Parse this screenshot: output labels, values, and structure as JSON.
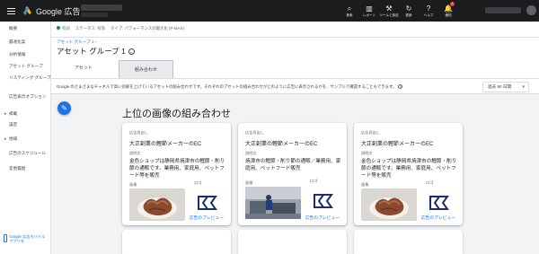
{
  "app": {
    "title": "Google 広告"
  },
  "toolbar": [
    {
      "name": "search",
      "icon": "⌕",
      "label": "検索"
    },
    {
      "name": "reports",
      "icon": "▥",
      "label": "レポート"
    },
    {
      "name": "tools",
      "icon": "⚒",
      "label": "ツールと設定"
    },
    {
      "name": "refresh",
      "icon": "↻",
      "label": "更新"
    },
    {
      "name": "help",
      "icon": "?",
      "label": "ヘルプ"
    },
    {
      "name": "notifications",
      "icon": "🔔",
      "label": "通知",
      "badge": "1"
    }
  ],
  "sidebar": {
    "items": [
      {
        "label": "概要"
      },
      {
        "label": "最適化案"
      },
      {
        "label": "分析情報"
      },
      {
        "label": "アセット グループ"
      },
      {
        "label": "リスティング グループ"
      },
      {
        "label": "広告表示オプション"
      },
      {
        "label": "掲載",
        "caret": "▸"
      },
      {
        "label": "設定"
      },
      {
        "label": "地域",
        "caret": "▸"
      },
      {
        "label": "広告のスケジュール"
      },
      {
        "label": "変更履歴"
      }
    ],
    "mobile_banner": "Google 広告モバイルアプリを"
  },
  "status": {
    "enabled": "有効",
    "status_label": "ステータス: 有効",
    "type": "タイプ: パフォーマンスの最大化 (P-MAX)"
  },
  "breadcrumb": "アセット グループ 1 ›",
  "page_title": "アセット グループ 1",
  "tabs": [
    {
      "label": "アセット",
      "active": false
    },
    {
      "label": "組み合わせ",
      "active": true
    }
  ],
  "info": {
    "text": "Google のさまざまなチャネルで高い効果を上げているアセットの組み合わせです。それぞれのアセットの組み合わせがどのように広告に表示されるかを、サンプルで確認することもできます。",
    "help_icon": "?"
  },
  "date_range": {
    "value": "過去 90 日間",
    "chevron": "▾"
  },
  "fab": {
    "icon": "✎"
  },
  "section_title": "上位の画像の組み合わせ",
  "labels": {
    "headline": "広告見出し",
    "description": "説明文",
    "image": "画像",
    "logo": "ロゴ",
    "preview": "広告のプレビュー"
  },
  "cards": [
    {
      "headline": "大正創業の鰹節メーカーのEC",
      "description": "金色ショップは静岡県焼津市の鰹節・削り節の通販です。業務用、家庭用、ペットフード等を販売",
      "image": "food"
    },
    {
      "headline": "大正創業の鰹節メーカーのEC",
      "description": "焼津市の鰹節・削り節の通販／業務用、家庭用、ペットフード販売",
      "image": "factory"
    },
    {
      "headline": "大正創業の鰹節メーカーのEC",
      "description": "金色ショップは静岡県焼津市の鰹節・削り節の通販です。業務用、家庭用、ペットフード等を販売",
      "image": "food"
    }
  ],
  "colors": {
    "brand_blue": "#1a73e8",
    "topbar": "#1a1c1e",
    "status_green": "#1e8e3e"
  }
}
